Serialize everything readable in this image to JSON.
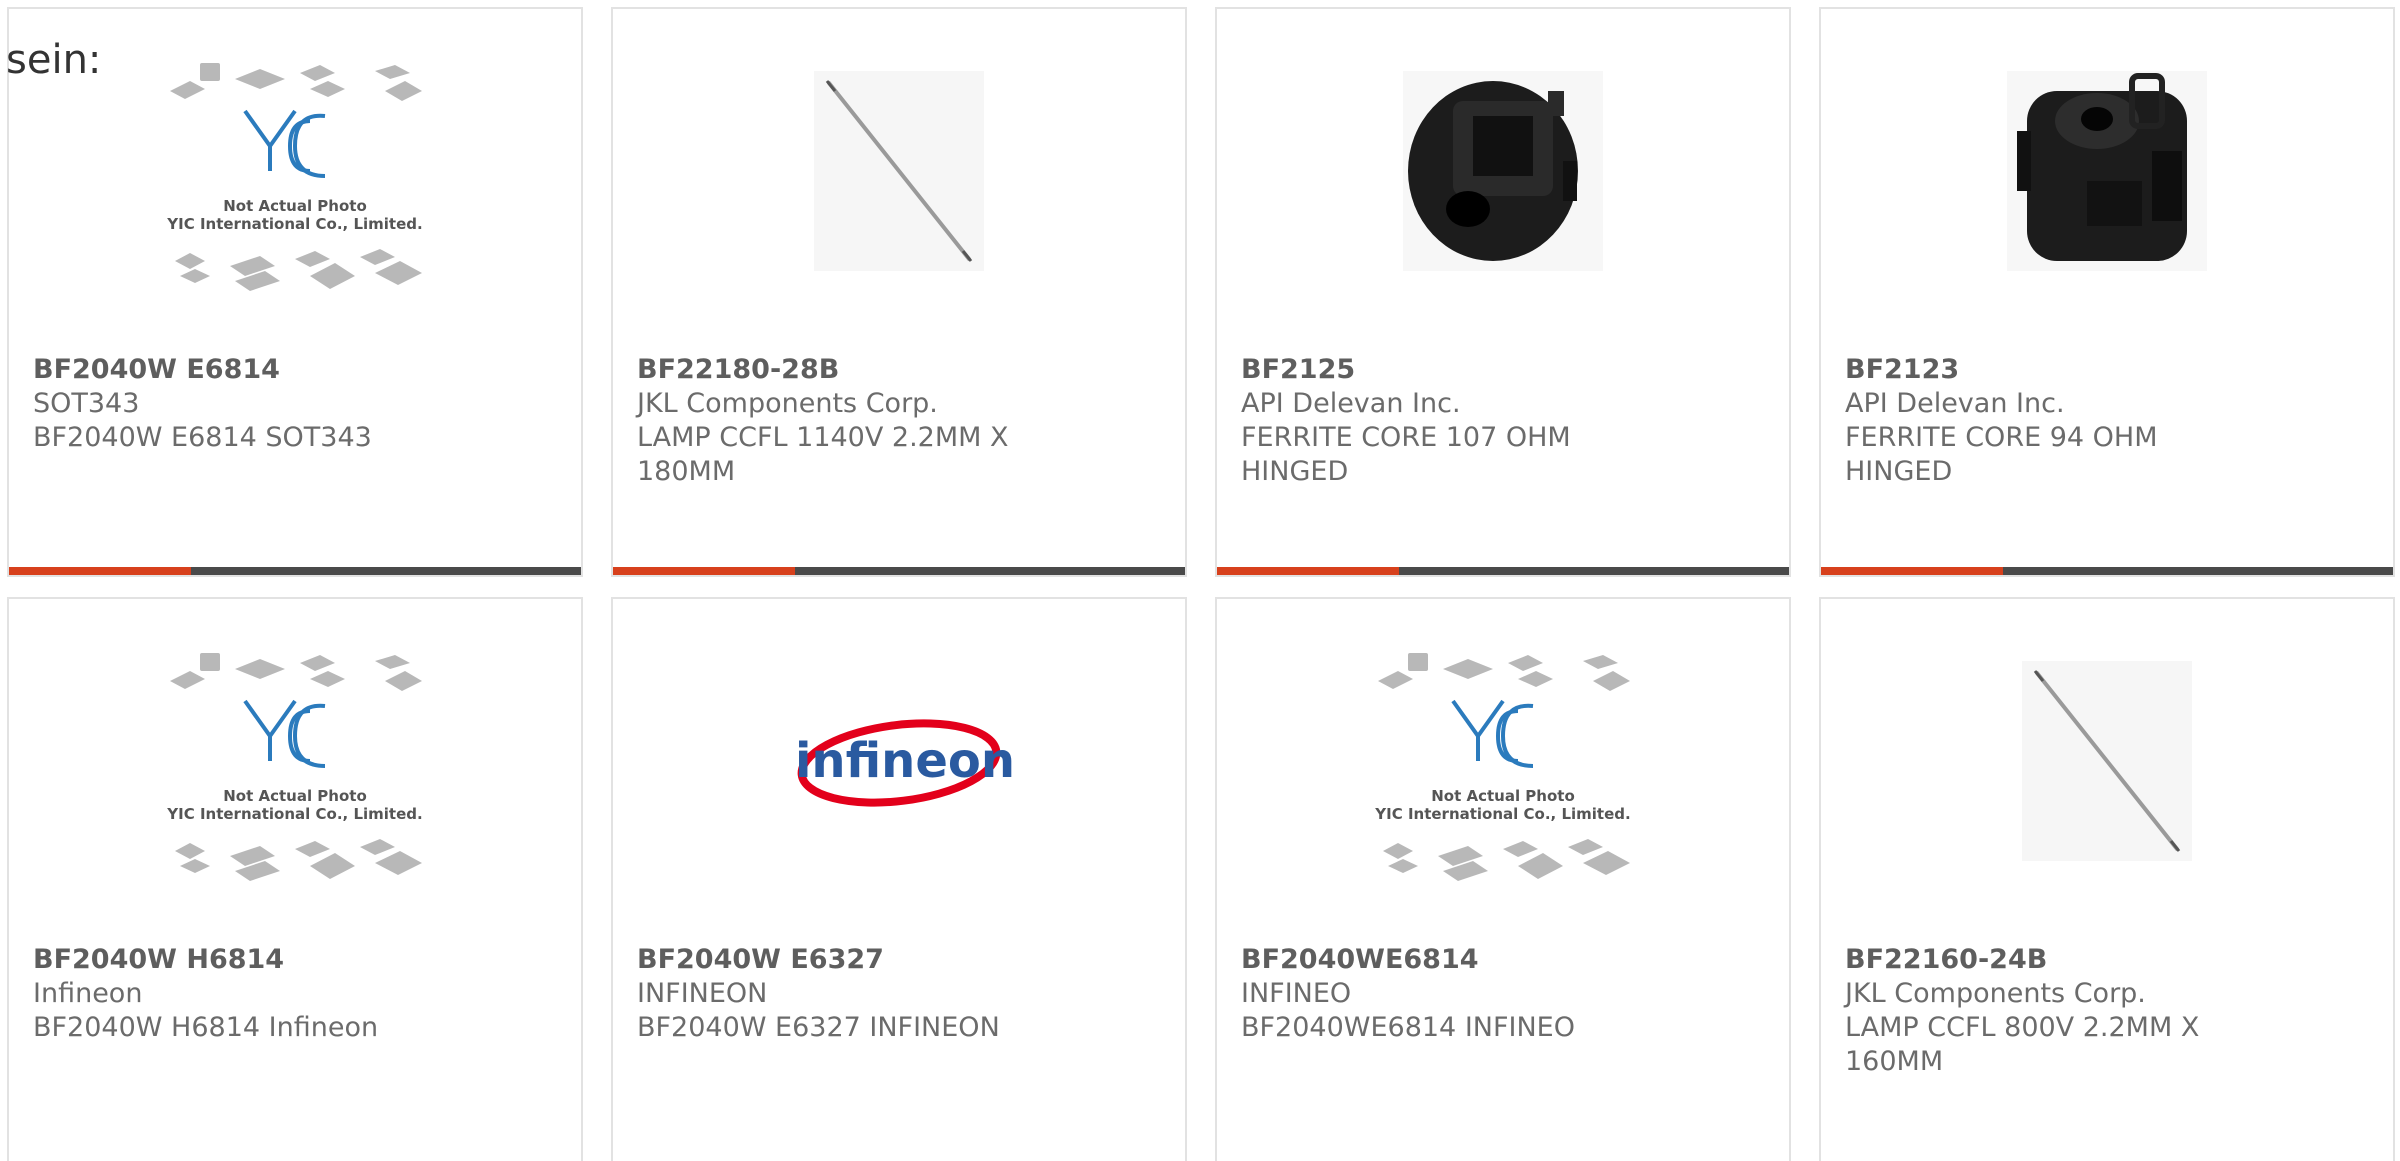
{
  "lead_text": "sein:",
  "colors": {
    "accent_bar": "#d7401c",
    "dark_bar": "#4a4a4a",
    "card_border": "#e2e2e2",
    "text": "#6b6b6b"
  },
  "placeholder": {
    "caption_line1": "Not Actual Photo",
    "caption_line2": "YIC International Co., Limited.",
    "logo_text": "YIC"
  },
  "products": [
    {
      "part_number": "BF2040W E6814",
      "manufacturer": "SOT343",
      "description": "BF2040W E6814 SOT343",
      "image": "yic-placeholder"
    },
    {
      "part_number": "BF22180-28B",
      "manufacturer": "JKL Components Corp.",
      "description": "LAMP CCFL 1140V 2.2MM X 180MM",
      "image": "ccfl-lamp"
    },
    {
      "part_number": "BF2125",
      "manufacturer": "API Delevan Inc.",
      "description": "FERRITE CORE 107 OHM HINGED",
      "image": "ferrite-core"
    },
    {
      "part_number": "BF2123",
      "manufacturer": "API Delevan Inc.",
      "description": "FERRITE CORE 94 OHM HINGED",
      "image": "ferrite-core"
    },
    {
      "part_number": "BF2040W H6814",
      "manufacturer": "Infineon",
      "description": "BF2040W H6814 Infineon",
      "image": "yic-placeholder"
    },
    {
      "part_number": "BF2040W E6327",
      "manufacturer": "INFINEON",
      "description": "BF2040W E6327 INFINEON",
      "image": "infineon-logo"
    },
    {
      "part_number": "BF2040WE6814",
      "manufacturer": "INFINEO",
      "description": "BF2040WE6814 INFINEO",
      "image": "yic-placeholder"
    },
    {
      "part_number": "BF22160-24B",
      "manufacturer": "JKL Components Corp.",
      "description": "LAMP CCFL 800V 2.2MM X 160MM",
      "image": "ccfl-lamp"
    }
  ],
  "infineon_logo_text": "infineon"
}
